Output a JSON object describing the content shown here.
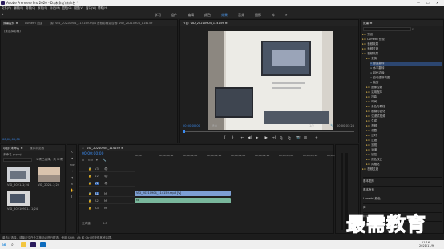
{
  "titlebar": {
    "app_title": "Adobe Premiere Pro 2020 - D:\\未命名\\未命名 *",
    "minimize": "—",
    "maximize": "☐",
    "close": "✕"
  },
  "menu": [
    "文件(F)",
    "编辑(E)",
    "剪辑(C)",
    "序列(S)",
    "标记(M)",
    "图形(G)",
    "视图(V)",
    "窗口(W)",
    "帮助(H)"
  ],
  "workspaces": [
    "学习",
    "组件",
    "编辑",
    "颜色",
    "效果",
    "音频",
    "图形",
    "库"
  ],
  "workspace_active_index": 4,
  "left_panel": {
    "tabs": [
      "效果控件 ≡",
      "Lumetri 范围",
      "源: VID_20210904_114159.mp4",
      "音频剪辑混合器: VID_20210904_114159"
    ],
    "empty_text": "(未选择剪辑)",
    "timecode": "00;00;00;00"
  },
  "program_monitor": {
    "tab": "节目: VID_20210904_114159 ≡",
    "timecode": "00;00;00;00",
    "fit": "适合",
    "quality": "1/2",
    "duration": "00;00;01;24"
  },
  "transport": [
    "{",
    "}",
    "|←",
    "◀|",
    "▶",
    "|▶",
    "→|",
    "⎘",
    "⎗",
    "📷",
    "⊞",
    "+"
  ],
  "effects_panel": {
    "tab": "效果 ≡",
    "items": [
      {
        "label": "预设",
        "level": 0
      },
      {
        "label": "Lumetri 预设",
        "level": 0
      },
      {
        "label": "音频效果",
        "level": 0
      },
      {
        "label": "音频过渡",
        "level": 0
      },
      {
        "label": "视频效果",
        "level": 0
      },
      {
        "label": "变换",
        "level": 1
      },
      {
        "label": "垂直翻转",
        "level": 2,
        "selected": true
      },
      {
        "label": "水平翻转",
        "level": 2
      },
      {
        "label": "羽化边缘",
        "level": 2
      },
      {
        "label": "自动重新构图",
        "level": 2
      },
      {
        "label": "裁剪",
        "level": 2
      },
      {
        "label": "图像控制",
        "level": 1
      },
      {
        "label": "实用程序",
        "level": 1
      },
      {
        "label": "扭曲",
        "level": 1
      },
      {
        "label": "时间",
        "level": 1
      },
      {
        "label": "杂色与颗粒",
        "level": 1
      },
      {
        "label": "模糊与锐化",
        "level": 1
      },
      {
        "label": "沉浸式视频",
        "level": 1
      },
      {
        "label": "生成",
        "level": 1
      },
      {
        "label": "视频",
        "level": 1
      },
      {
        "label": "调整",
        "level": 1
      },
      {
        "label": "过时",
        "level": 1
      },
      {
        "label": "过渡",
        "level": 1
      },
      {
        "label": "透视",
        "level": 1
      },
      {
        "label": "通道",
        "level": 1
      },
      {
        "label": "键控",
        "level": 1
      },
      {
        "label": "颜色校正",
        "level": 1
      },
      {
        "label": "风格化",
        "level": 1
      },
      {
        "label": "视频过渡",
        "level": 0
      }
    ],
    "sub_panels": [
      "基本图形",
      "基本声音",
      "Lumetri 颜色",
      "库",
      "标记",
      "历史记录"
    ]
  },
  "project_panel": {
    "tabs": [
      "项目: 未命名 ≡",
      "媒体浏览器"
    ],
    "project_name": "未命名.prproj",
    "item_count": "1 项已选择，共 2 项",
    "items": [
      {
        "name": "VID_2021..",
        "duration": "1;24"
      },
      {
        "name": "VID_2021..",
        "duration": "1;24"
      },
      {
        "name": "VID_20210911..",
        "duration": "1;24"
      }
    ]
  },
  "timeline": {
    "tab": "VID_20210904_114159 ≡",
    "timecode": "00;00;00;00",
    "ruler": [
      "00;00",
      "00;00;00;16",
      "00;00;01;00",
      "00;00;01;16",
      "00;00;02;00",
      "00;00;02;16",
      "00;00;03;00",
      "00;00;03;16",
      "00;00;04;00"
    ],
    "tracks": [
      "V3",
      "V2",
      "V1",
      "A1",
      "A2",
      "A3"
    ],
    "master": "主声道",
    "master_value": "0.0",
    "clip_video": "VID_20210904_114159.mp4 [V]",
    "clip_audio": "fx"
  },
  "statusbar": {
    "text": "单击以选择，或单击空白处并拖动以进行框选。使用 Shift、Alt 和 Ctrl 可获得其他选项。"
  },
  "taskbar": {
    "time": "11:16",
    "date": "2021/11/9"
  },
  "watermark": "最需教育",
  "colors": {
    "accent": "#4d9bf0",
    "video_clip": "#7d9fd4",
    "audio_clip": "#79b79c"
  }
}
